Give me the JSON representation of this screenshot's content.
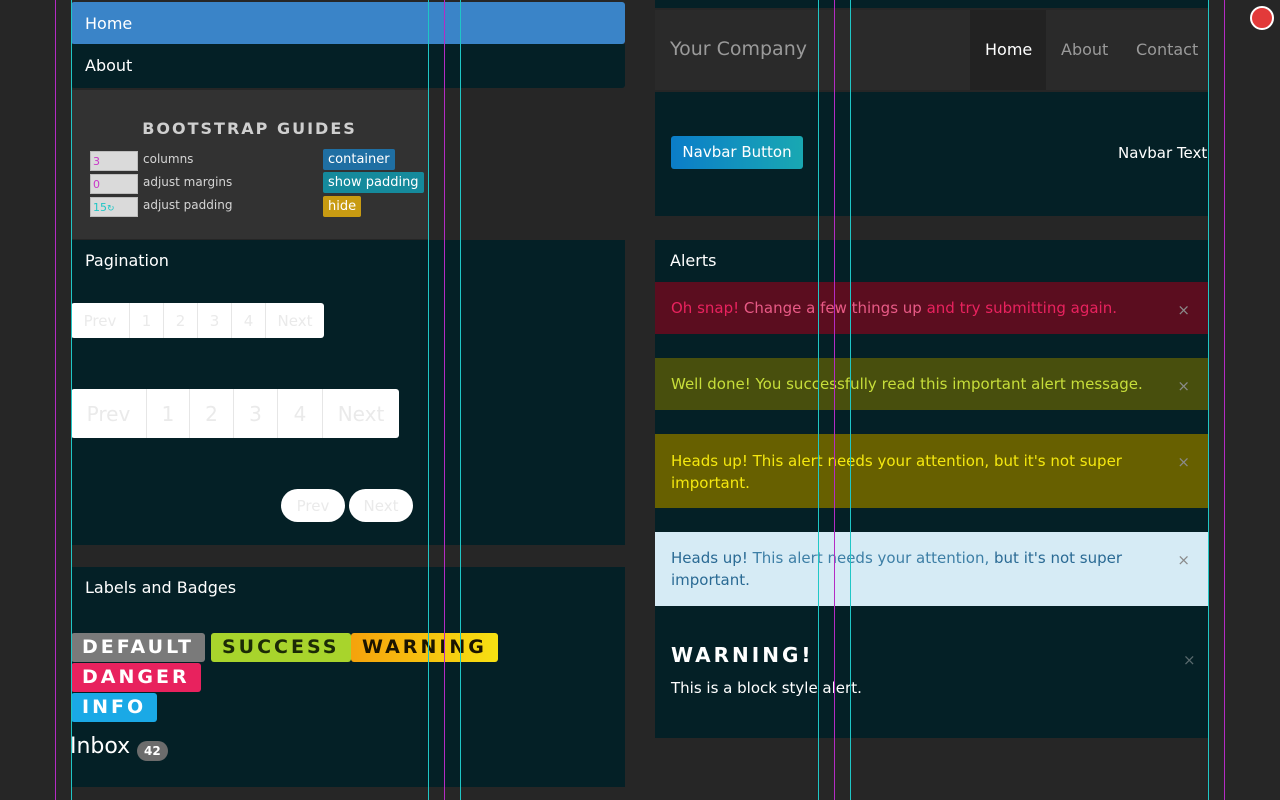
{
  "sidebar": {
    "items": [
      {
        "label": "Home"
      },
      {
        "label": "About"
      }
    ]
  },
  "guides": {
    "title": "BOOTSTRAP GUIDES",
    "rows": [
      {
        "value": "3",
        "label": "columns",
        "value_color": "#c837c8"
      },
      {
        "value": "0",
        "label": "adjust margins",
        "value_color": "#c837c8"
      },
      {
        "value": "15",
        "label": "adjust padding",
        "value_color": "#1fc6c6"
      }
    ],
    "buttons": [
      {
        "label": "container",
        "color": "#1f6fa3"
      },
      {
        "label": "show padding",
        "color": "#158a9c"
      },
      {
        "label": "hide",
        "color": "#c89b12"
      }
    ]
  },
  "pagination": {
    "title": "Pagination",
    "small": [
      "Prev",
      "1",
      "2",
      "3",
      "4",
      "Next"
    ],
    "large": [
      "Prev",
      "1",
      "2",
      "3",
      "4",
      "Next"
    ],
    "pager": {
      "prev": "Prev",
      "next": "Next"
    }
  },
  "labels": {
    "title": "Labels and Badges",
    "items": [
      {
        "text": "DEFAULT",
        "color": "#7a7a7a"
      },
      {
        "text": "SUCCESS",
        "color": "#a8d42c"
      },
      {
        "text": "WARNING",
        "color": "#f5c518"
      },
      {
        "text": "DANGER",
        "color": "#e8225e"
      },
      {
        "text": "INFO",
        "color": "#1aa9e6"
      }
    ],
    "inbox": {
      "text": "Inbox",
      "badge": "42"
    }
  },
  "topnav": {
    "brand": "Your Company",
    "links": [
      {
        "label": "Home",
        "active": true
      },
      {
        "label": "About",
        "active": false
      },
      {
        "label": "Contact",
        "active": false
      }
    ]
  },
  "navbar": {
    "button": "Navbar Button",
    "text": "Navbar Text"
  },
  "alerts": {
    "title": "Alerts",
    "close": "×",
    "danger": {
      "strong": "Oh snap!",
      "link": "Change a few things up",
      "rest": "and try submitting again."
    },
    "success": {
      "text": "Well done! You successfully read this important alert message."
    },
    "warning": {
      "text": "Heads up! This alert needs your attention, but it's not super important."
    },
    "info": {
      "strong": "Heads up!",
      "mid": "This alert needs your attention,",
      "rest": "but it's not super important."
    },
    "block": {
      "heading": "WARNING!",
      "text": "This is a block style alert."
    }
  }
}
